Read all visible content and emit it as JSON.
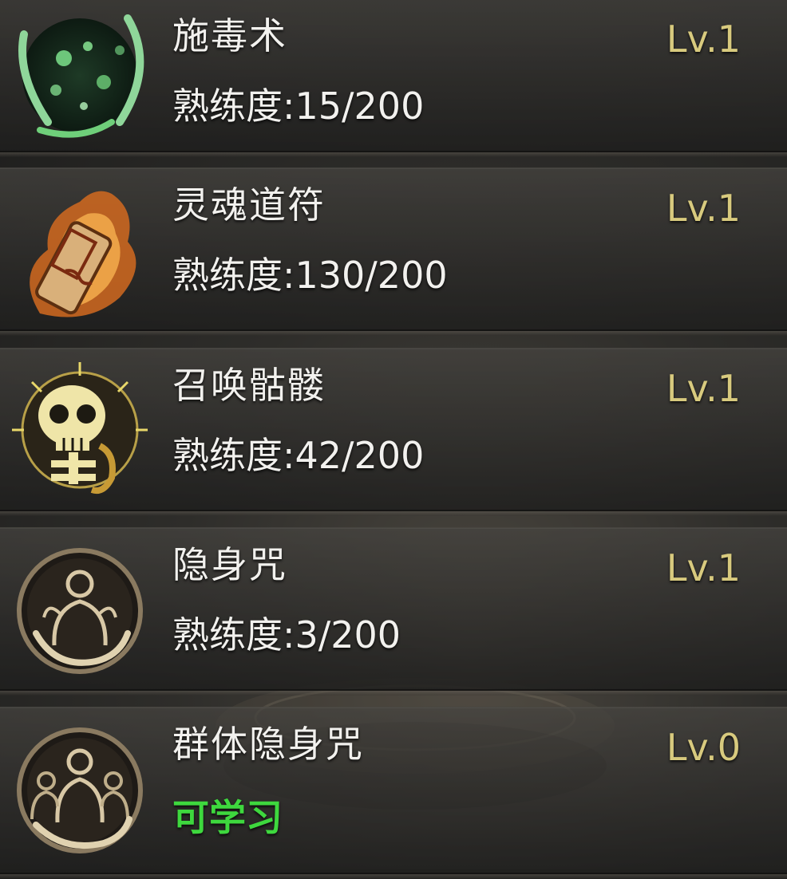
{
  "skills": [
    {
      "name": "施毒术",
      "level": "Lv.1",
      "proficiency_label": "熟练度:",
      "proficiency_value": "15/200",
      "icon": "poison-orb-icon",
      "accent": "#6fcf7a"
    },
    {
      "name": "灵魂道符",
      "level": "Lv.1",
      "proficiency_label": "熟练度:",
      "proficiency_value": "130/200",
      "icon": "burning-talisman-icon",
      "accent": "#e8a040"
    },
    {
      "name": "召唤骷髅",
      "level": "Lv.1",
      "proficiency_label": "熟练度:",
      "proficiency_value": "42/200",
      "icon": "skeleton-skull-icon",
      "accent": "#e9d86a"
    },
    {
      "name": "隐身咒",
      "level": "Lv.1",
      "proficiency_label": "熟练度:",
      "proficiency_value": "3/200",
      "icon": "invisibility-figure-icon",
      "accent": "#cdbb95"
    },
    {
      "name": "群体隐身咒",
      "level": "Lv.0",
      "status": "可学习",
      "icon": "group-invisibility-icon",
      "accent": "#cdbb95"
    }
  ],
  "colors": {
    "level": "#d8ca7e",
    "text": "#f2f1ee",
    "learnable": "#3ed83e"
  }
}
